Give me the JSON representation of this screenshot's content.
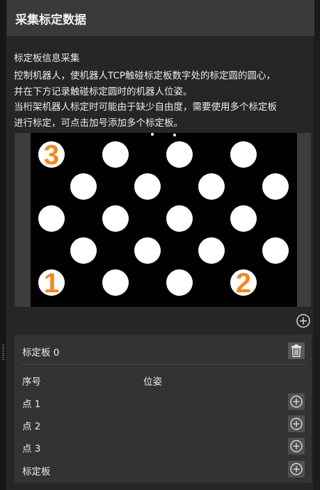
{
  "header": {
    "title": "采集标定数据"
  },
  "section": {
    "title": "标定板信息采集",
    "description_lines": [
      "控制机器人，使机器人TCP触碰标定板数字处的标定圆的圆心，",
      "并在下方记录触碰标定圆时的机器人位姿。",
      "当桁架机器人标定时可能由于缺少自由度，需要使用多个标定板",
      "进行标定，可点击加号添加多个标定板。"
    ]
  },
  "board_image": {
    "marker_labels": [
      "3",
      "1",
      "2"
    ],
    "marker_color": "#f08a24"
  },
  "card": {
    "title": "标定板 0",
    "columns": [
      "序号",
      "位姿"
    ],
    "rows": [
      {
        "label": "点 1"
      },
      {
        "label": "点 2"
      },
      {
        "label": "点 3"
      },
      {
        "label": "标定板"
      }
    ]
  },
  "icons": {
    "add": "plus-circle-icon",
    "delete": "trash-icon"
  }
}
